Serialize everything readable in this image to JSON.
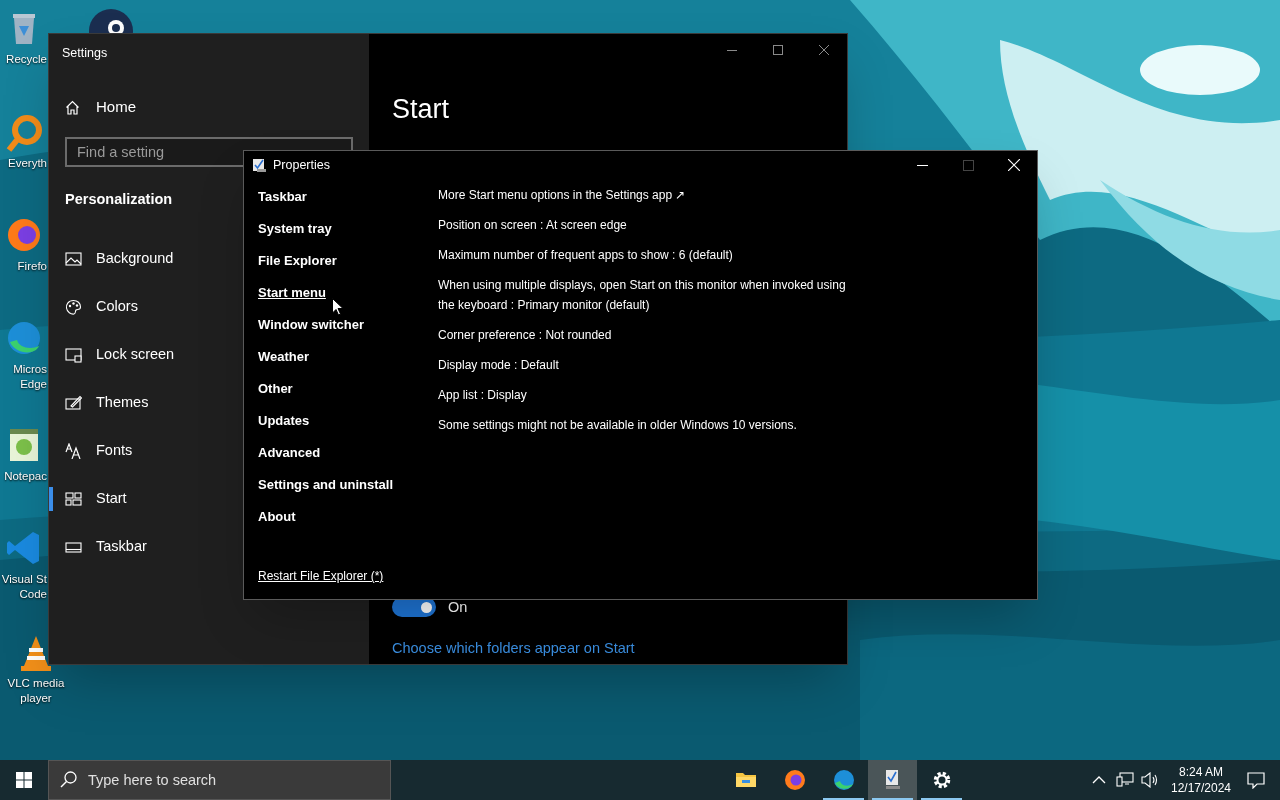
{
  "desktop": {
    "icons": [
      {
        "kind": "recycle",
        "lines": [
          "Recycle"
        ]
      },
      {
        "kind": "search-app",
        "lines": [
          "Everyth"
        ]
      },
      {
        "kind": "firefox",
        "lines": [
          "Firefo"
        ]
      },
      {
        "kind": "edge",
        "lines": [
          "Micros",
          "Edge"
        ]
      },
      {
        "kind": "notepad",
        "lines": [
          "Notepac"
        ]
      },
      {
        "kind": "vscode",
        "lines": [
          "Visual St",
          "Code"
        ]
      },
      {
        "kind": "vlc",
        "lines": [
          "VLC media",
          "player"
        ]
      }
    ]
  },
  "settings_window": {
    "title": "Settings",
    "home": "Home",
    "search": {
      "placeholder": "Find a setting"
    },
    "section": "Personalization",
    "items": [
      {
        "kind": "background",
        "label": "Background",
        "selected": false
      },
      {
        "kind": "colors",
        "label": "Colors",
        "selected": false
      },
      {
        "kind": "lock",
        "label": "Lock screen",
        "selected": false
      },
      {
        "kind": "themes",
        "label": "Themes",
        "selected": false
      },
      {
        "kind": "fonts",
        "label": "Fonts",
        "selected": false
      },
      {
        "kind": "start",
        "label": "Start",
        "selected": true
      },
      {
        "kind": "taskbar",
        "label": "Taskbar",
        "selected": false
      }
    ],
    "page_title": "Start",
    "toggle": {
      "on": true,
      "label": "On"
    },
    "link": "Choose which folders appear on Start"
  },
  "properties_window": {
    "title": "Properties",
    "nav": [
      {
        "label": "Taskbar",
        "selected": false
      },
      {
        "label": "System tray",
        "selected": false
      },
      {
        "label": "File Explorer",
        "selected": false
      },
      {
        "label": "Start menu",
        "selected": true
      },
      {
        "label": "Window switcher",
        "selected": false
      },
      {
        "label": "Weather",
        "selected": false
      },
      {
        "label": "Other",
        "selected": false
      },
      {
        "label": "Updates",
        "selected": false
      },
      {
        "label": "Advanced",
        "selected": false
      },
      {
        "label": "Settings and uninstall",
        "selected": false
      },
      {
        "label": "About",
        "selected": false
      }
    ],
    "lines": [
      "More Start menu options in the Settings app ↗",
      "Position on screen : At screen edge",
      "Maximum number of frequent apps to show : 6 (default)",
      "When using multiple displays, open Start on this monitor when invoked using the keyboard : Primary monitor (default)",
      "Corner preference : Not rounded",
      "Display mode : Default",
      "App list : Display",
      "Some settings might not be available in older Windows 10 versions."
    ],
    "footer_link": "Restart File Explorer (*)"
  },
  "taskbar": {
    "search": {
      "placeholder": "Type here to search"
    },
    "apps": [
      {
        "kind": "folder",
        "running": false,
        "active": false
      },
      {
        "kind": "firefox",
        "running": false,
        "active": false
      },
      {
        "kind": "edge",
        "running": true,
        "active": false
      },
      {
        "kind": "properties",
        "running": true,
        "active": true
      },
      {
        "kind": "gear",
        "running": true,
        "active": false
      }
    ],
    "time": "8:24 AM",
    "date": "12/17/2024"
  }
}
